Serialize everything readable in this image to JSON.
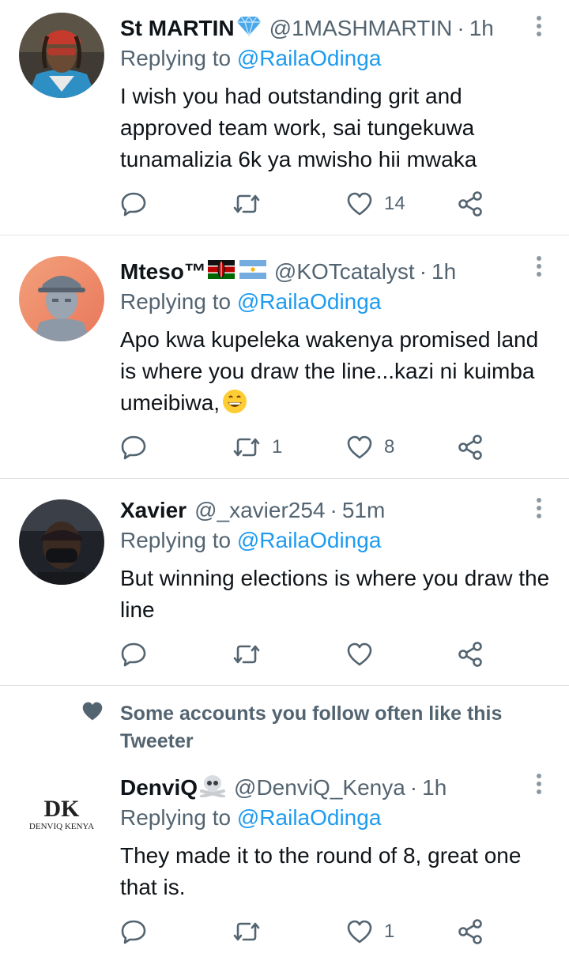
{
  "tweets": [
    {
      "name": "St MARTIN",
      "badge": "gem-icon",
      "handle": "@1MASHMARTIN",
      "time": "1h",
      "reply_prefix": "Replying to",
      "reply_to": "@RailaOdinga",
      "text": "I wish you had outstanding grit and approved team work, sai tungekuwa tunamalizia 6k ya mwisho hii mwaka",
      "retweets": "",
      "likes": "14"
    },
    {
      "name": "Mteso™",
      "badge": "kenya-flag-argentina-flag",
      "handle": "@KOTcatalyst",
      "time": "1h",
      "reply_prefix": "Replying to",
      "reply_to": "@RailaOdinga",
      "text": "Apo kwa kupeleka wakenya promised land is where you draw the line...kazi ni kuimba umeibiwa,",
      "retweets": "1",
      "likes": "8"
    },
    {
      "name": "Xavier",
      "handle": "@_xavier254",
      "time": "51m",
      "reply_prefix": "Replying to",
      "reply_to": "@RailaOdinga",
      "text": "But winning elections is where you draw the line",
      "retweets": "",
      "likes": ""
    },
    {
      "name": "DenviQ",
      "badge": "skull-crossbones-icon",
      "handle": "@DenviQ_Kenya",
      "time": "1h",
      "reply_prefix": "Replying to",
      "reply_to": "@RailaOdinga",
      "text": "They made it to the round of 8, great one that is.",
      "retweets": "",
      "likes": "1",
      "avatar_logo": "DK",
      "avatar_sub": "DENVIQ KENYA"
    }
  ],
  "social_context": "Some accounts you follow often like this Tweeter",
  "colors": {
    "link": "#1d9bf0",
    "muted": "#536471",
    "text": "#0f1419",
    "divider": "#dfe3e6"
  }
}
